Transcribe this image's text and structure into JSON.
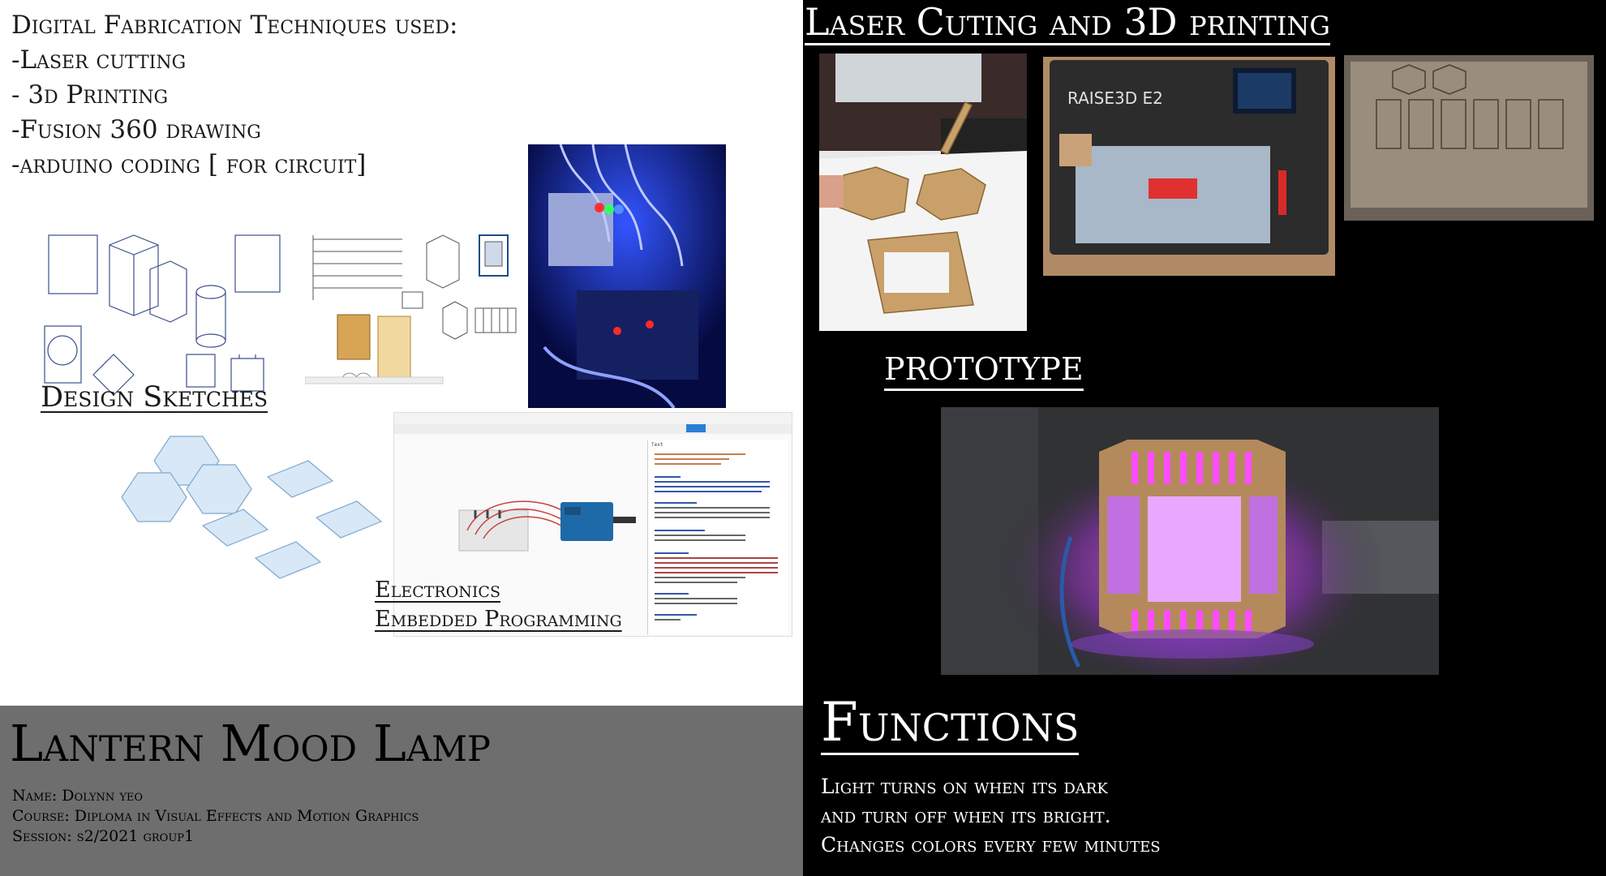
{
  "techniques": {
    "heading": "Digital Fabrication Techniques used:",
    "items": [
      "-Laser cutting",
      "- 3d Printing",
      "-Fusion 360 drawing",
      "-arduino coding [ for circuit]"
    ]
  },
  "captions": {
    "design_sketches": "Design Sketches",
    "electronics": "Electronics",
    "embedded_programming": "Embedded Programming"
  },
  "footer": {
    "title": "Lantern Mood Lamp",
    "name": "Name: Dolynn yeo",
    "course": "Course: Diploma in Visual Effects and Motion Graphics",
    "session": "Session: s2/2021 group1"
  },
  "right": {
    "laser_heading": "Laser Cuting and  3D printing",
    "prototype_heading": "prototype",
    "functions_heading": "Functions",
    "functions_lines": [
      "Light turns on when its dark",
      "and turn off when its bright.",
      "Changes colors every few minutes"
    ]
  },
  "images": {
    "printer_brand": "RAISE3D E2",
    "editor_tab": "Text"
  },
  "colors": {
    "left_bg": "#ffffff",
    "footer_bg": "#6e6e6e",
    "right_bg": "#000000",
    "lamp_glow": "#e040ff"
  }
}
